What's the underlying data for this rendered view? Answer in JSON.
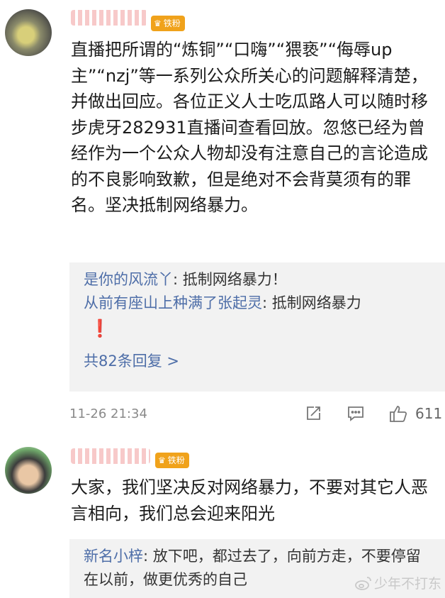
{
  "comments": [
    {
      "badge": "铁粉",
      "text": "直播把所谓的“炼铜”“口嗨”“猥亵”“侮辱up主”“nzj”等一系列公众所关心的问题解释清楚，并做出回应。各位正义人士吃瓜路人可以随时移步虎牙282931直播间查看回放。忽悠已经为曾经作为一个公众人物却没有注意自己的言论造成的不良影响致歉，但是绝对不会背莫须有的罪名。坚决抵制网络暴力。",
      "replies": [
        {
          "name": "是你的风流丫",
          "sep": ": ",
          "text": "抵制网络暴力！"
        },
        {
          "name": "从前有座山上种满了张起灵",
          "sep": ": ",
          "text": "抵制网络暴力"
        }
      ],
      "reply_mark": "❗",
      "reply_count": "共82条回复 >",
      "timestamp": "11-26 21:34",
      "likes": "611"
    },
    {
      "badge": "铁粉",
      "text": "大家，我们坚决反对网络暴力，不要对其它人恶言相向，我们总会迎来阳光",
      "replies": [
        {
          "name": "新名小梓",
          "sep": ": ",
          "text": "放下吧，都过去了，向前方走，不要停留在以前，做更优秀的自己"
        }
      ]
    }
  ],
  "watermark": "少年不打东"
}
